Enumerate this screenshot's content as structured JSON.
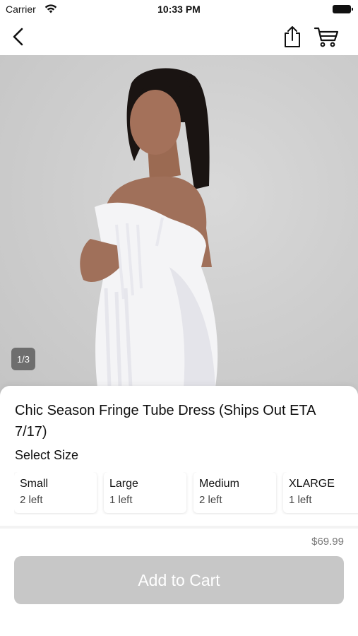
{
  "status_bar": {
    "carrier": "Carrier",
    "time": "10:33 PM"
  },
  "nav": {
    "back_icon": "chevron-left-icon",
    "share_icon": "share-icon",
    "cart_icon": "cart-icon"
  },
  "product": {
    "image_counter": "1/3",
    "title": "Chic Season Fringe Tube Dress (Ships Out ETA 7/17)",
    "select_size_label": "Select Size",
    "sizes": [
      {
        "name": "Small",
        "stock": "2 left"
      },
      {
        "name": "Large",
        "stock": "1 left"
      },
      {
        "name": "Medium",
        "stock": "2 left"
      },
      {
        "name": "XLARGE",
        "stock": "1 left"
      }
    ],
    "price": "$69.99",
    "add_to_cart_label": "Add to Cart"
  },
  "colors": {
    "button_disabled": "#c7c7c7",
    "image_background": "#cfcfcf"
  }
}
